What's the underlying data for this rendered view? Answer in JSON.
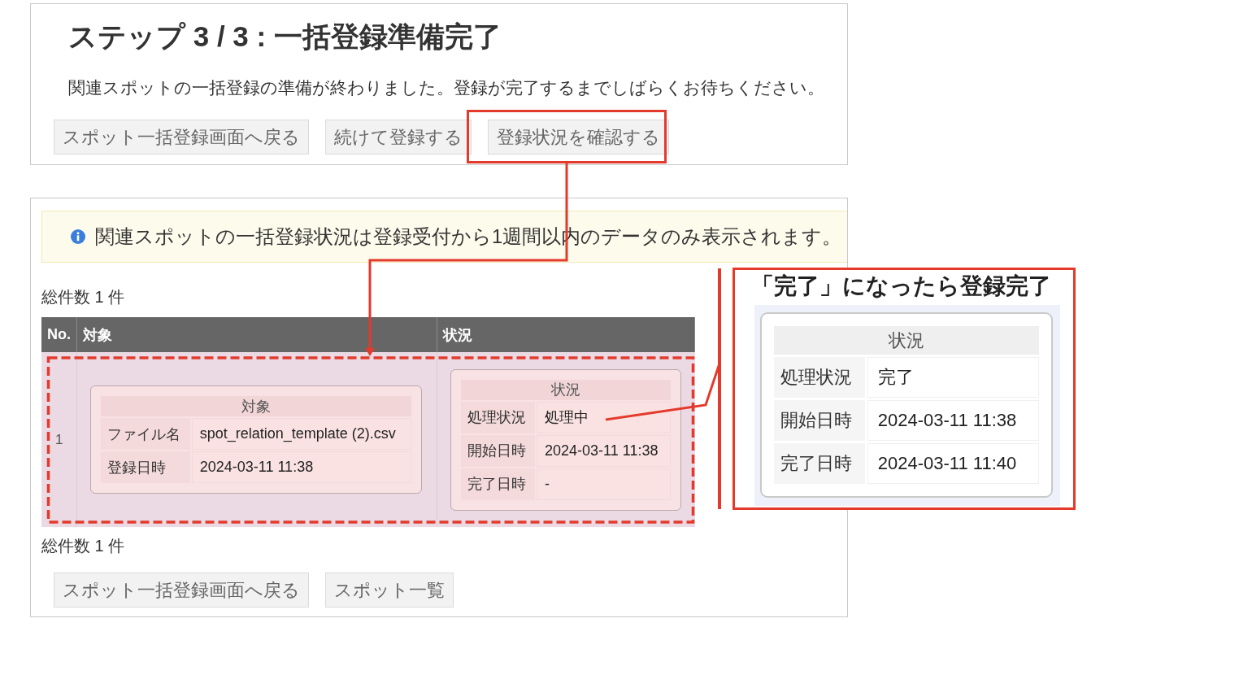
{
  "step_panel": {
    "title": "ステップ 3 / 3 : 一括登録準備完了",
    "message": "関連スポットの一括登録の準備が終わりました。登録が完了するまでしばらくお待ちください。",
    "buttons": [
      "スポット一括登録画面へ戻る",
      "続けて登録する",
      "登録状況を確認する"
    ]
  },
  "status_panel": {
    "notice": "関連スポットの一括登録状況は登録受付から1週間以内のデータのみ表示されます。",
    "total_top": "総件数 1 件",
    "table": {
      "columns": [
        "No.",
        "対象",
        "状況"
      ],
      "rows": [
        {
          "no": "1",
          "highlighted": true,
          "target": {
            "title": "対象",
            "fields": [
              {
                "label": "ファイル名",
                "value": "spot_relation_template (2).csv"
              },
              {
                "label": "登録日時",
                "value": "2024-03-11 11:38"
              }
            ]
          },
          "status": {
            "title": "状況",
            "fields": [
              {
                "label": "処理状況",
                "value": "処理中"
              },
              {
                "label": "開始日時",
                "value": "2024-03-11 11:38"
              },
              {
                "label": "完了日時",
                "value": "-"
              }
            ]
          }
        }
      ]
    },
    "total_bottom": "総件数 1 件",
    "buttons": [
      "スポット一括登録画面へ戻る",
      "スポット一覧"
    ]
  },
  "callout": {
    "title": "「完了」になったら登録完了",
    "card": {
      "title": "状況",
      "fields": [
        {
          "label": "処理状況",
          "value": "完了"
        },
        {
          "label": "開始日時",
          "value": "2024-03-11 11:38"
        },
        {
          "label": "完了日時",
          "value": "2024-03-11 11:40"
        }
      ]
    }
  }
}
